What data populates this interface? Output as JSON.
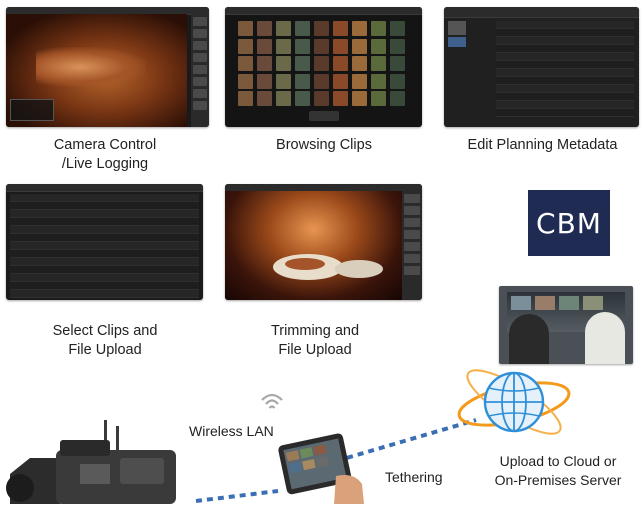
{
  "captions": {
    "camera_control": [
      "Camera  Control",
      "/Live Logging"
    ],
    "browsing_clips": "Browsing Clips",
    "edit_planning": "Edit Planning Metadata",
    "select_clips": [
      "Select Clips and",
      "File Upload"
    ],
    "trimming": [
      "Trimming and",
      "File Upload"
    ]
  },
  "logo": {
    "text": "CBM"
  },
  "connections": {
    "wireless_lan": "Wireless LAN",
    "tethering": "Tethering",
    "upload": [
      "Upload to Cloud or",
      "On-Premises Server"
    ]
  },
  "colors": {
    "link_blue": "#3a6fb4",
    "globe_orange": "#f39a1b",
    "globe_blue": "#2f8fd8",
    "logo_bg": "#1f2b52"
  },
  "icons": [
    "wifi-icon",
    "globe-icon",
    "camcorder-icon",
    "tablet-icon"
  ]
}
